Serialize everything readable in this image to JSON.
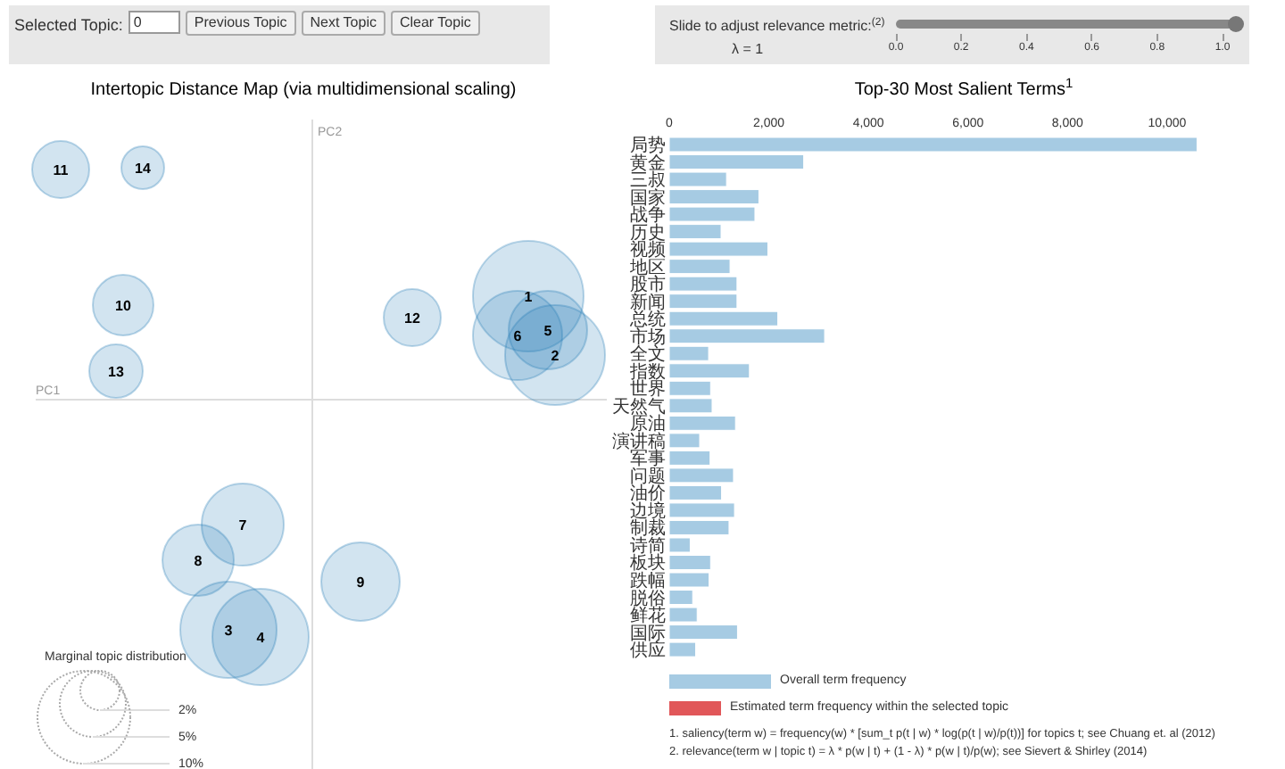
{
  "controls": {
    "label": "Selected Topic:",
    "topic_input": "0",
    "buttons": [
      "Previous Topic",
      "Next Topic",
      "Clear Topic"
    ]
  },
  "map": {
    "title": "Intertopic Distance Map (via multidimensional scaling)",
    "axes": [
      "PC1",
      "PC2"
    ],
    "topics": [
      {
        "label": "11"
      },
      {
        "label": "14"
      },
      {
        "label": "10"
      },
      {
        "label": "13"
      },
      {
        "label": "12"
      },
      {
        "label": "1"
      },
      {
        "label": "6"
      },
      {
        "label": "5"
      },
      {
        "label": "2"
      },
      {
        "label": "7"
      },
      {
        "label": "8"
      },
      {
        "label": "9"
      },
      {
        "label": "3"
      },
      {
        "label": "4"
      }
    ],
    "legend": {
      "title": "Marginal topic distribution",
      "sizes": [
        "2%",
        "5%",
        "10%"
      ]
    }
  },
  "relevance": {
    "label": "Slide to adjust relevance metric:$^{(2)}$",
    "level": 1,
    "reading": "λ = 1",
    "ticks": [
      "0.0",
      "0.2",
      "0.4",
      "0.6",
      "0.8",
      "1.0"
    ]
  },
  "terms": {
    "title": "Top-30 Most Salient Terms$^{1}$",
    "chart_data": {
      "type": "bar",
      "orientation": "horizontal",
      "categories": [
        "局势",
        "黄金",
        "三叔",
        "国家",
        "战争",
        "历史",
        "视频",
        "地区",
        "股市",
        "新闻",
        "总统",
        "市场",
        "全文",
        "指数",
        "世界",
        "天然气",
        "原油",
        "演讲稿",
        "军事",
        "问题",
        "油价",
        "边境",
        "制裁",
        "诗简",
        "板块",
        "跌幅",
        "脱俗",
        "鲜花",
        "国际",
        "供应"
      ],
      "series": [
        {
          "name": "Overall term frequency",
          "color": "#a6cbe3",
          "values": [
            10600,
            2700,
            1150,
            1800,
            1720,
            1040,
            1980,
            1220,
            1360,
            1360,
            2180,
            3120,
            790,
            1610,
            830,
            860,
            1330,
            610,
            820,
            1290,
            1050,
            1310,
            1200,
            420,
            830,
            800,
            470,
            560,
            1370,
            530
          ]
        }
      ],
      "xlim": [
        0,
        10600
      ],
      "xticks": [
        0,
        {
          "value": 2000,
          "label": "2,000"
        },
        {
          "value": 4000,
          "label": "4,000"
        },
        {
          "value": 6000,
          "label": "6,000"
        },
        {
          "value": 8000,
          "label": "8,000"
        },
        {
          "value": 10000,
          "label": "10,000"
        }
      ]
    }
  },
  "legend": [
    {
      "label": "Estimated term frequency within the selected topic",
      "color": "#e15759"
    }
  ],
  "notes": [
    "1. saliency(term w) = frequency(w) * [sum_t p(t | w) * log(p(t | w)/p(t))] for topics t; see Chuang et. al (2012)",
    "2. relevance(term w | topic t) = λ * p(w | t) + (1 - λ) * p(w | t)/p(w); see Sievert & Shirley (2014)"
  ]
}
